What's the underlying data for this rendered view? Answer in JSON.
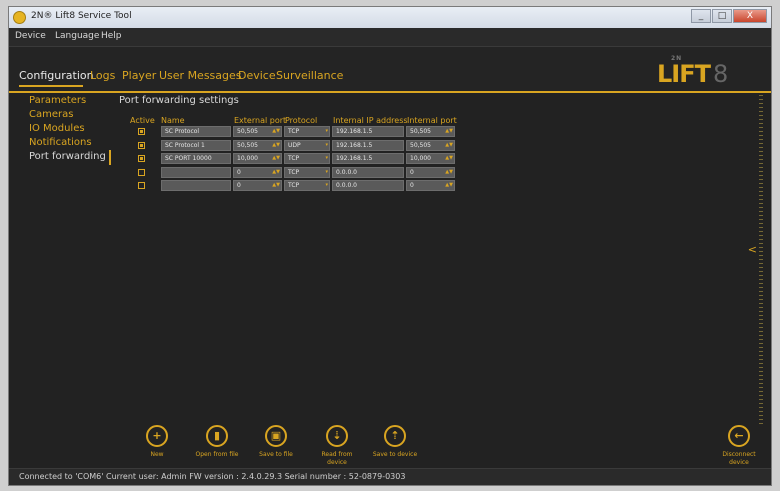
{
  "window": {
    "title": "2N® Lift8 Service Tool",
    "buttons": [
      "_",
      "□",
      "X"
    ]
  },
  "menu": [
    "Device",
    "Language",
    "Help"
  ],
  "nav": {
    "tabs": [
      "Configuration",
      "Logs",
      "Player",
      "User Messages",
      "Device",
      "Surveillance"
    ],
    "active": "Configuration"
  },
  "logo": {
    "small": "2N",
    "main": "LIFT",
    "num": "8"
  },
  "sidebar": [
    "Parameters",
    "Cameras",
    "IO Modules",
    "Notifications",
    "Port forwarding"
  ],
  "section_title": "Port forwarding settings",
  "table": {
    "headers": [
      "Active",
      "Name",
      "External port",
      "Protocol",
      "Internal IP address",
      "Internal port"
    ],
    "rows": [
      {
        "active": true,
        "name": "SC Protocol",
        "ext": "50,505",
        "proto": "TCP",
        "ip": "192.168.1.5",
        "intp": "50,505"
      },
      {
        "active": true,
        "name": "SC Protocol 1",
        "ext": "50,505",
        "proto": "UDP",
        "ip": "192.168.1.5",
        "intp": "50,505"
      },
      {
        "active": true,
        "name": "SC PORT 10000",
        "ext": "10,000",
        "proto": "TCP",
        "ip": "192.168.1.5",
        "intp": "10,000"
      },
      {
        "active": false,
        "name": "",
        "ext": "0",
        "proto": "TCP",
        "ip": "0.0.0.0",
        "intp": "0"
      },
      {
        "active": false,
        "name": "",
        "ext": "0",
        "proto": "TCP",
        "ip": "0.0.0.0",
        "intp": "0"
      }
    ]
  },
  "actions": [
    {
      "label": "New",
      "icon": "plus-icon",
      "glyph": "+"
    },
    {
      "label": "Open from file",
      "icon": "file-icon",
      "glyph": "▮"
    },
    {
      "label": "Save to file",
      "icon": "disk-icon",
      "glyph": "▣"
    },
    {
      "label": "Read from device",
      "icon": "download-icon",
      "glyph": "⇣"
    },
    {
      "label": "Save to device",
      "icon": "upload-icon",
      "glyph": "⇡"
    }
  ],
  "disconnect": {
    "label": "Disconnect device",
    "icon": "back-arrow-icon",
    "glyph": "←"
  },
  "status": "Connected to 'COM6'  Current user: Admin  FW version : 2.4.0.29.3  Serial number : 52-0879-0303",
  "colors": {
    "accent": "#d9a521",
    "background": "#222222"
  }
}
